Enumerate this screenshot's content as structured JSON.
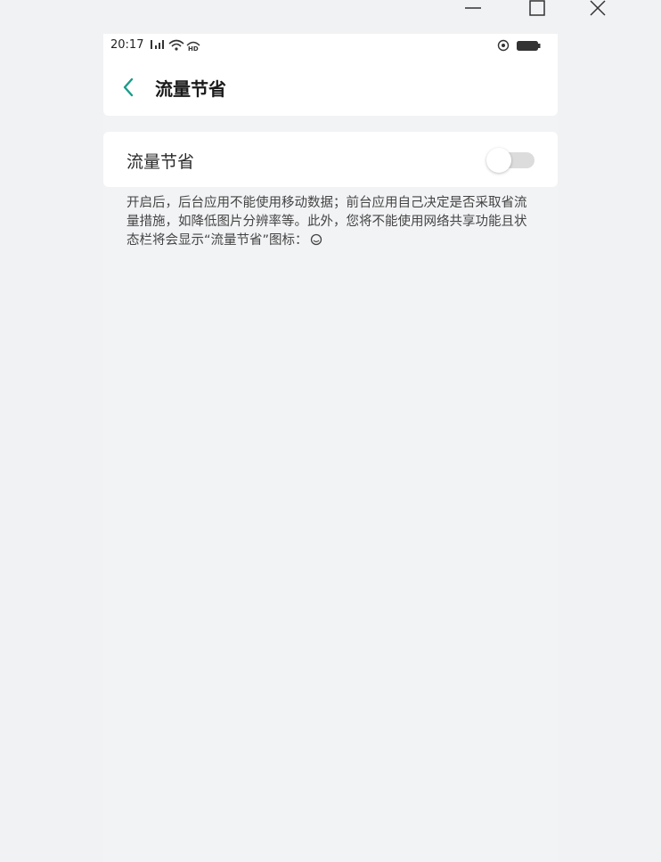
{
  "window": {
    "controls": [
      "minimize",
      "maximize",
      "close"
    ]
  },
  "status_bar": {
    "time": "20:17",
    "left_icons": [
      "signal-icon",
      "wifi-icon",
      "hd-icon"
    ],
    "right_icons": [
      "data-saver-status-icon",
      "battery-icon"
    ]
  },
  "header": {
    "back_icon": "chevron-left-icon",
    "title": "流量节省",
    "accent_color": "#1a9c8a"
  },
  "setting": {
    "label": "流量节省",
    "toggle_state": "off"
  },
  "description": {
    "text": "开启后，后台应用不能使用移动数据；前台应用自己决定是否采取省流量措施，如降低图片分辨率等。此外，您将不能使用网络共享功能且状态栏将会显示“流量节省”图标：",
    "trailing_icon": "data-saver-icon"
  }
}
